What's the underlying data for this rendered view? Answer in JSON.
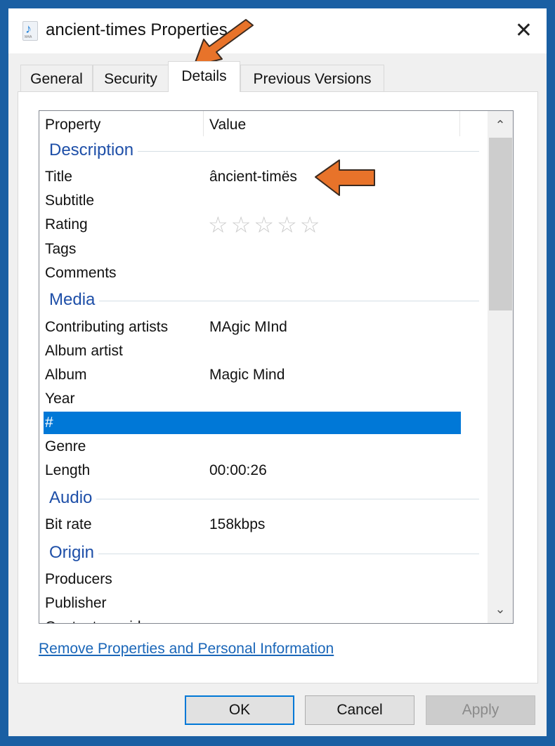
{
  "window": {
    "title": "ancient-times Properties",
    "icon_label": "M4A"
  },
  "tabs": [
    {
      "label": "General"
    },
    {
      "label": "Security"
    },
    {
      "label": "Details"
    },
    {
      "label": "Previous Versions"
    }
  ],
  "list": {
    "header": {
      "property": "Property",
      "value": "Value"
    },
    "rows": [
      {
        "type": "group",
        "label": "Description"
      },
      {
        "type": "row",
        "key": "Title",
        "value": "âncient-timës"
      },
      {
        "type": "row",
        "key": "Subtitle",
        "value": ""
      },
      {
        "type": "rating",
        "key": "Rating",
        "stars": 0,
        "max": 5
      },
      {
        "type": "row",
        "key": "Tags",
        "value": ""
      },
      {
        "type": "row",
        "key": "Comments",
        "value": ""
      },
      {
        "type": "group",
        "label": "Media"
      },
      {
        "type": "row",
        "key": "Contributing artists",
        "value": "MAgic MInd"
      },
      {
        "type": "row",
        "key": "Album artist",
        "value": ""
      },
      {
        "type": "row",
        "key": "Album",
        "value": "Magic Mind"
      },
      {
        "type": "row",
        "key": "Year",
        "value": ""
      },
      {
        "type": "row",
        "key": "#",
        "value": "",
        "selected": true
      },
      {
        "type": "row",
        "key": "Genre",
        "value": ""
      },
      {
        "type": "row",
        "key": "Length",
        "value": "00:00:26"
      },
      {
        "type": "group",
        "label": "Audio"
      },
      {
        "type": "row",
        "key": "Bit rate",
        "value": "158kbps"
      },
      {
        "type": "group",
        "label": "Origin"
      },
      {
        "type": "row",
        "key": "Producers",
        "value": ""
      },
      {
        "type": "row",
        "key": "Publisher",
        "value": ""
      },
      {
        "type": "row",
        "key": "Content provider",
        "value": ""
      }
    ]
  },
  "link": "Remove Properties and Personal Information",
  "buttons": {
    "ok": "OK",
    "cancel": "Cancel",
    "apply": "Apply"
  },
  "colors": {
    "accent": "#0078d7",
    "arrow": "#e8732a",
    "group": "#1e4fa8"
  }
}
